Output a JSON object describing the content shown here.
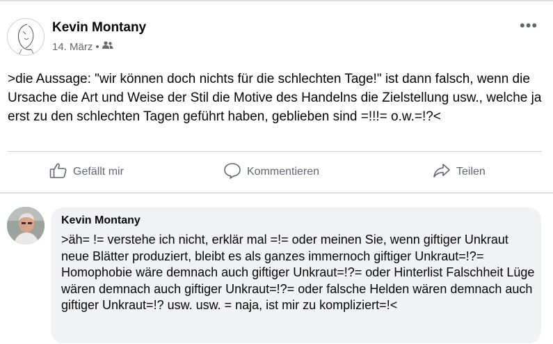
{
  "post": {
    "author": "Kevin Montany",
    "date": "14. März",
    "separator": "•",
    "audience_icon": "friends-icon",
    "more_icon": "more-options-icon",
    "more_glyph": "•••",
    "text": ">die Aussage: \"wir können doch nichts für die schlechten Tage!\" ist dann falsch, wenn die Ursache die Art und Weise der Stil die Motive des Handelns die Zielstellung usw., welche ja erst zu den schlechten Tagen geführt haben, geblieben sind =!!!= o.w.=!?<"
  },
  "actions": {
    "like_label": "Gefällt mir",
    "comment_label": "Kommentieren",
    "share_label": "Teilen"
  },
  "comment": {
    "author": "Kevin Montany",
    "text": ">äh= != verstehe ich nicht, erklär mal =!= oder meinen Sie, wenn giftiger Unkraut neue Blätter produziert, bleibt es als ganzes immernoch giftiger Unkraut=!?= Homophobie wäre demnach auch giftiger Unkraut=!?= oder Hinterlist Falschheit Lüge wären demnach auch giftiger Unkraut=!?= oder falsche Helden wären demnach auch giftiger Unkraut=!? usw. usw. = naja, ist mir zu kompliziert=!<"
  },
  "colors": {
    "text": "#050505",
    "secondary": "#65676b",
    "bubble": "#f0f2f5",
    "divider": "#ced0d4"
  }
}
